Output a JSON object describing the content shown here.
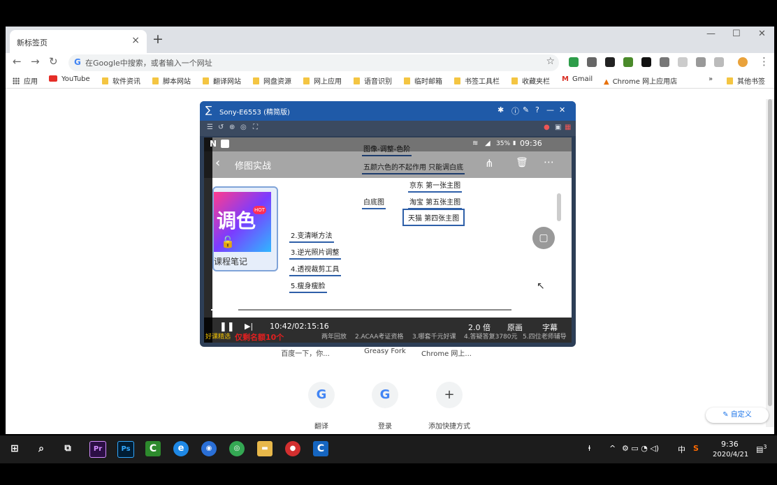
{
  "browser": {
    "tab_title": "新标签页",
    "omnibox_placeholder": "在Google中搜索，或者输入一个网址",
    "bookmarks": [
      "应用",
      "YouTube",
      "软件资讯",
      "脚本网站",
      "翻译网站",
      "网盘资源",
      "网上应用",
      "语音识别",
      "临时邮箱",
      "书签工具栏",
      "收藏夹栏",
      "Gmail",
      "Chrome 网上应用店"
    ],
    "other_bookmarks": "其他书签",
    "overflow": "»"
  },
  "new_tab_page": {
    "top_labels": [
      "百度一下，你...",
      "Greasy Fork",
      "Chrome 网上..."
    ],
    "shortcuts": [
      {
        "label": "翻译",
        "icon": "G"
      },
      {
        "label": "登录",
        "icon": "G"
      },
      {
        "label": "添加快捷方式",
        "icon": "+"
      }
    ],
    "customize_label": "自定义"
  },
  "player": {
    "title": "Sony-E6553 (精简版)",
    "phone_status": {
      "battery": "35%",
      "time": "09:36"
    },
    "app_title": "修图实战",
    "mindmap": {
      "top_nodes": [
        "图像-调整-色阶",
        "五颜六色的不起作用 只能调白底"
      ],
      "branch_label": "白底图",
      "branch_children": [
        "京东 第一张主图",
        "淘宝  第五张主图",
        "天猫  第四张主图"
      ],
      "list_nodes": [
        "2.变清晰方法",
        "3.逆光照片调整",
        "4.透视裁剪工具",
        "5.瘦身瘦脸"
      ],
      "poster_text": "调色",
      "poster_badge": "HOT",
      "poster_caption": "课程笔记"
    },
    "playback": {
      "time": "10:42/02:15:16",
      "speed": "2.0 倍",
      "quality": "原画",
      "subtitle": "字幕",
      "progress": 0.079
    },
    "ticker": [
      "好课精选",
      "仅剩名额10个",
      "两年回放",
      "2.ACAA考证资格",
      "3.哪套千元好课",
      "4.答疑答复3780元",
      "5.四位老师辅导"
    ]
  },
  "taskbar": {
    "time": "9:36",
    "date": "2020/4/21",
    "ime": "中",
    "notifications": "3"
  }
}
